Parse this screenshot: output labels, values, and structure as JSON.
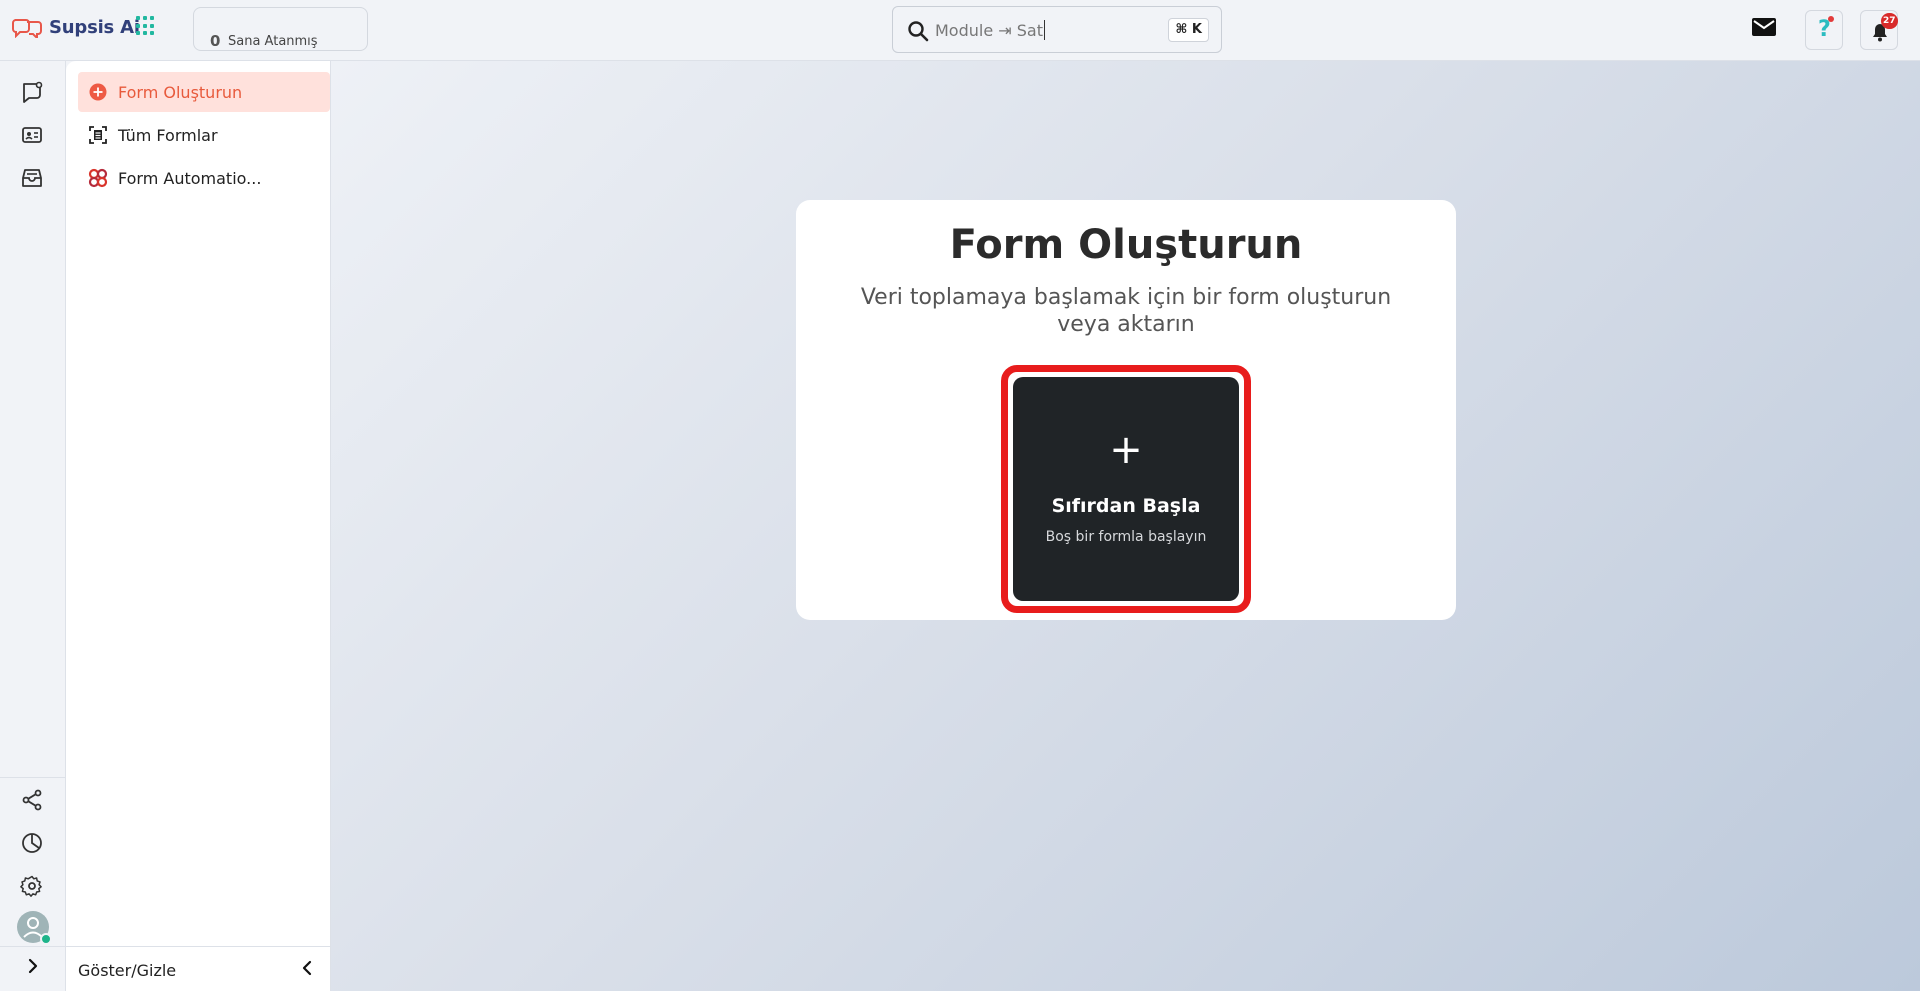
{
  "app": {
    "name": "Supsis Ai"
  },
  "topbar": {
    "assigned_count": "0",
    "assigned_label": "Sana Atanmış",
    "search_placeholder": "Module ⇥ Sat",
    "search_shortcut": "⌘ K",
    "notification_count": "27"
  },
  "sidebar": {
    "items": [
      {
        "label": "Form Oluşturun",
        "icon": "plus-circle-icon",
        "active": true
      },
      {
        "label": "Tüm Formlar",
        "icon": "form-list-icon",
        "active": false
      },
      {
        "label": "Form Automatio...",
        "icon": "automation-icon",
        "active": false
      }
    ],
    "footer_label": "Göster/Gizle"
  },
  "main": {
    "title": "Form Oluşturun",
    "subtitle": "Veri toplamaya başlamak için bir form oluşturun veya aktarın",
    "tile": {
      "plus": "+",
      "title": "Sıfırdan Başla",
      "subtitle": "Boş bir formla başlayın"
    }
  },
  "colors": {
    "accent": "#e85a3c",
    "highlight": "#e81c1c",
    "tile_bg": "#202427",
    "brand_text": "#31407a"
  }
}
